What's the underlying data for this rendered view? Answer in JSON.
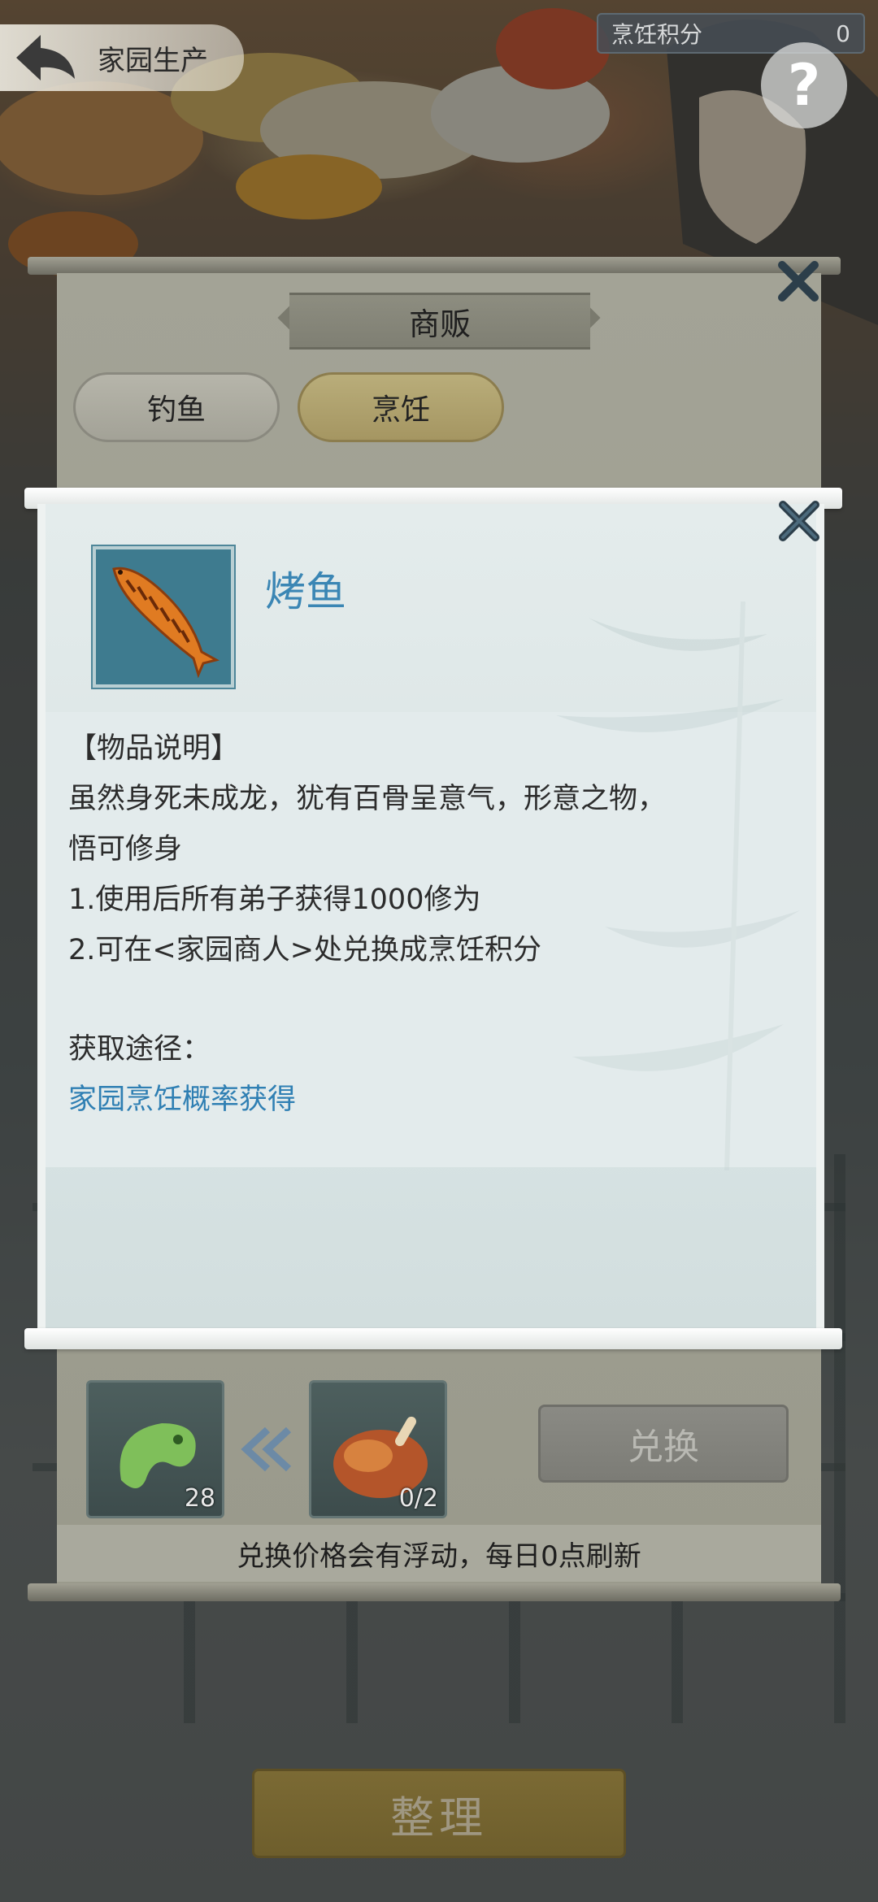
{
  "header": {
    "back_icon": "back-arrow-icon",
    "title": "家园生产",
    "score_label": "烹饪积分",
    "score_value": "0",
    "help_symbol": "?"
  },
  "shop": {
    "title": "商贩",
    "tabs": [
      {
        "label": "钓鱼",
        "active": false
      },
      {
        "label": "烹饪",
        "active": true
      }
    ],
    "cost_item_count": "28",
    "reward_item_progress": "0/2",
    "exchange_label": "兑换",
    "notice": "兑换价格会有浮动，每日0点刷新",
    "sort_label": "整理"
  },
  "detail": {
    "item_name": "烤鱼",
    "item_icon": "grilled-fish-icon",
    "desc_header": "【物品说明】",
    "desc_lines": [
      "虽然身死未成龙，犹有百骨呈意气，形意之物，",
      "悟可修身",
      "1.使用后所有弟子获得1000修为",
      "2.可在<家园商人>处兑换成烹饪积分"
    ],
    "source_label": "获取途径：",
    "source_value": "家园烹饪概率获得"
  },
  "colors": {
    "item_name": "#3b86b4",
    "source_link": "#2f7fb3",
    "icon_bg": "#3e7b8f"
  }
}
